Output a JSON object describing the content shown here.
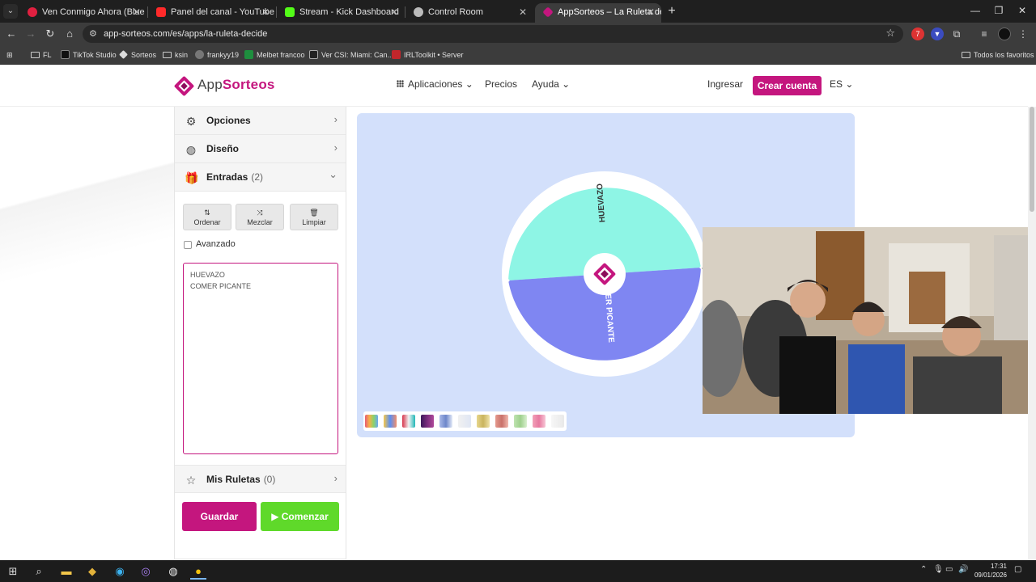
{
  "browser": {
    "tabs": [
      {
        "title": "Ven Conmigo Ahora (Blue E",
        "icon": "youtube-red-icon",
        "active": false
      },
      {
        "title": "Panel del canal - YouTube Studi",
        "icon": "youtube-studio-icon",
        "active": false
      },
      {
        "title": "Stream - Kick Dashboard",
        "icon": "kick-icon",
        "active": false
      },
      {
        "title": "Control Room",
        "icon": "control-room-icon",
        "active": false
      },
      {
        "title": "AppSorteos – La Ruleta de la Su",
        "icon": "appsorteos-icon",
        "active": true
      }
    ],
    "url": "app-sorteos.com/es/apps/la-ruleta-decide",
    "bookmarks": [
      {
        "label": "FL",
        "type": "folder"
      },
      {
        "label": "TikTok Studio",
        "type": "link"
      },
      {
        "label": "Sorteos",
        "type": "link"
      },
      {
        "label": "ksin",
        "type": "folder"
      },
      {
        "label": "frankyy19",
        "type": "link"
      },
      {
        "label": "Melbet francoo",
        "type": "link"
      },
      {
        "label": "Ver CSI: Miami: Can...",
        "type": "link"
      },
      {
        "label": "IRLToolkit • Server",
        "type": "link"
      }
    ],
    "all_bookmarks": "Todos los favoritos"
  },
  "header": {
    "logo_app": "App",
    "logo_sorteos": "Sorteos",
    "nav": {
      "apps": "Aplicaciones",
      "prices": "Precios",
      "help": "Ayuda"
    },
    "login": "Ingresar",
    "signup": "Crear cuenta",
    "lang": "ES"
  },
  "panel": {
    "options": "Opciones",
    "design": "Diseño",
    "entries": "Entradas",
    "entries_count": "(2)",
    "tools": {
      "sort": "Ordenar",
      "shuffle": "Mezclar",
      "clear": "Limpiar"
    },
    "advanced": "Avanzado",
    "entries_list": [
      "HUEVAZO",
      "COMER PICANTE"
    ],
    "my_wheels": "Mis Ruletas",
    "my_wheels_count": "(0)",
    "save": "Guardar",
    "start": "▶ Comenzar"
  },
  "wheel": {
    "segments": [
      {
        "label": "HUEVAZO",
        "color": "#8ef5e5"
      },
      {
        "label": "COMER PICANTE",
        "color": "#7f86f2"
      }
    ],
    "accent": "#c4167e"
  },
  "taskbar": {
    "time": "17:31",
    "date": "09/01/2026"
  }
}
